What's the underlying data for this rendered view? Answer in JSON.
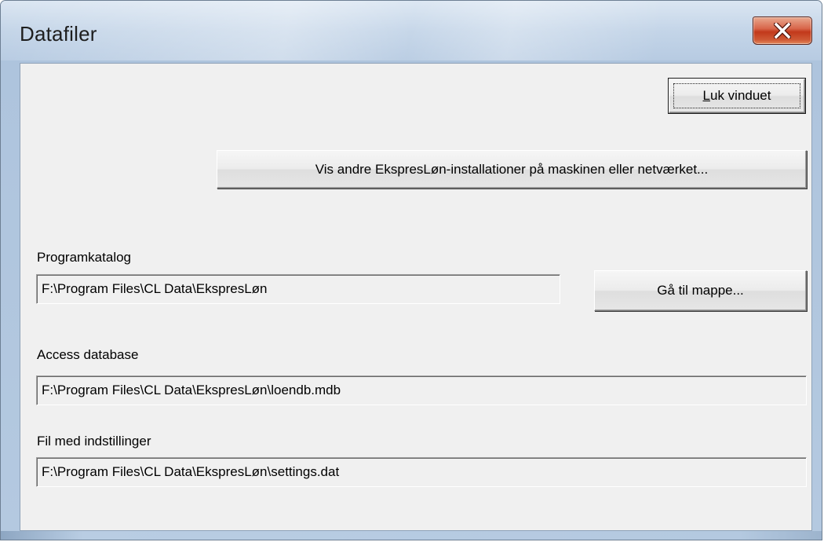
{
  "window": {
    "title": "Datafiler",
    "close_icon": "close-x-icon",
    "accent_color": "#c2391b"
  },
  "buttons": {
    "close_window_accesskey": "L",
    "close_window_rest": "uk vinduet",
    "show_installations": "Vis andre EkspresLøn-installationer på maskinen eller netværket...",
    "goto_folder": "Gå til mappe..."
  },
  "fields": {
    "program_dir_label": "Programkatalog",
    "program_dir_value": "F:\\Program Files\\CL Data\\EkspresLøn",
    "access_db_label": "Access database",
    "access_db_value": "F:\\Program Files\\CL Data\\EkspresLøn\\loendb.mdb",
    "settings_label": "Fil med indstillinger",
    "settings_value": "F:\\Program Files\\CL Data\\EkspresLøn\\settings.dat"
  }
}
